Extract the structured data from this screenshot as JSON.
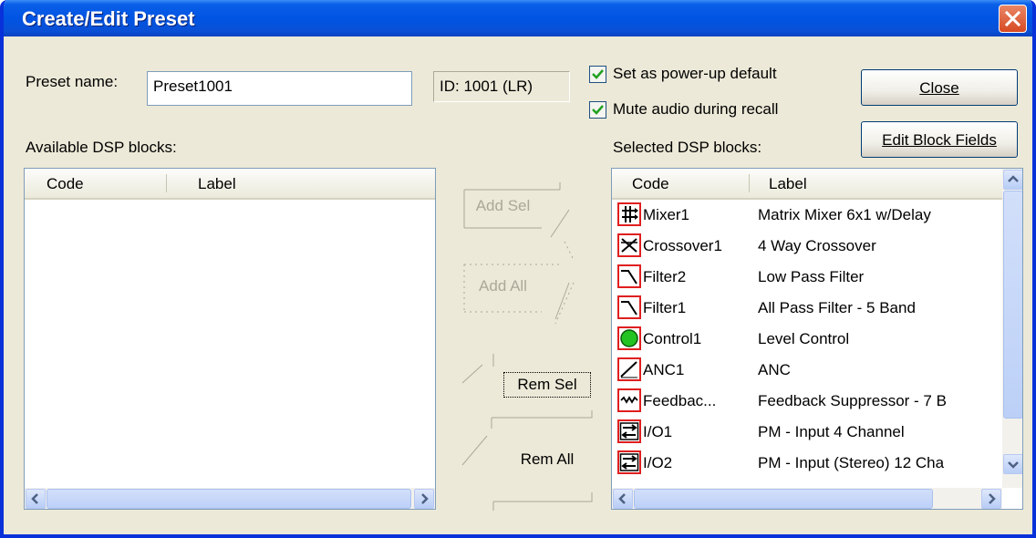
{
  "window": {
    "title": "Create/Edit Preset"
  },
  "preset": {
    "name_label": "Preset name:",
    "name_value": "Preset1001",
    "id_text": "ID: 1001 (LR)"
  },
  "options": {
    "powerup_label": "Set as power-up default",
    "mute_label": "Mute audio during recall",
    "powerup_checked": true,
    "mute_checked": true
  },
  "buttons": {
    "close": "Close",
    "edit_block_fields": "Edit Block Fields",
    "add_sel": "Add Sel",
    "add_all": "Add All",
    "rem_sel": "Rem Sel",
    "rem_all": "Rem All"
  },
  "available": {
    "title": "Available DSP blocks:",
    "columns": [
      "Code",
      "Label"
    ],
    "rows": []
  },
  "selected": {
    "title": "Selected DSP blocks:",
    "columns": [
      "Code",
      "Label"
    ],
    "rows": [
      {
        "icon": "mixer-icon",
        "code": "Mixer1",
        "label": "Matrix Mixer  6x1 w/Delay"
      },
      {
        "icon": "crossover-icon",
        "code": "Crossover1",
        "label": "4 Way  Crossover"
      },
      {
        "icon": "low-pass-filter-icon",
        "code": "Filter2",
        "label": "Low Pass Filter"
      },
      {
        "icon": "all-pass-filter-icon",
        "code": "Filter1",
        "label": "All Pass Filter - 5 Band"
      },
      {
        "icon": "level-control-icon",
        "code": "Control1",
        "label": "Level Control"
      },
      {
        "icon": "anc-icon",
        "code": "ANC1",
        "label": "ANC"
      },
      {
        "icon": "feedback-suppressor-icon",
        "code": "Feedbac...",
        "label": "Feedback Suppressor - 7 B"
      },
      {
        "icon": "io-icon",
        "code": "I/O1",
        "label": "PM - Input  4 Channel"
      },
      {
        "icon": "io-icon",
        "code": "I/O2",
        "label": "PM -  Input (Stereo)  12 Cha"
      }
    ]
  },
  "colors": {
    "titlebar": "#0054e3",
    "face": "#ece9d8",
    "icon_border": "#e01f1f",
    "control_green": "#22c322"
  }
}
